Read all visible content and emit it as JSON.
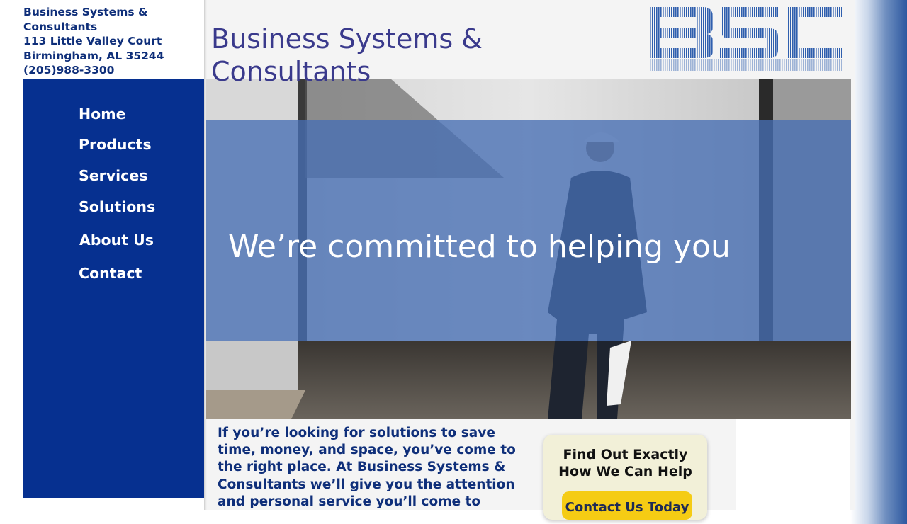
{
  "address": {
    "company": "Business Systems &",
    "company2": "Consultants",
    "street": "113 Little Valley Court",
    "city": "Birmingham, AL 35244",
    "phone": "(205)988-3300"
  },
  "site_title": {
    "line1": "Business Systems &",
    "line2": "Consultants"
  },
  "logo": {
    "text": "BSC"
  },
  "nav": {
    "items": [
      {
        "label": "Home"
      },
      {
        "label": "Products"
      },
      {
        "label": "Services"
      },
      {
        "label": "Solutions"
      },
      {
        "label": "About Us"
      },
      {
        "label": "Contact"
      }
    ]
  },
  "hero": {
    "tagline": "We’re committed to helping you"
  },
  "intro": {
    "lines": [
      "If you’re looking for solutions to save",
      "time, money, and space, you’ve come to",
      "the right place. At Business Systems &",
      "Consultants we’ll give you the attention",
      "and personal service you’ll come to"
    ]
  },
  "promo": {
    "heading1": "Find Out Exactly",
    "heading2": "How We Can Help",
    "button_label": "Contact Us Today"
  },
  "colors": {
    "sidebar": "#063090",
    "title": "#3a3a8c",
    "text": "#0f2f7a",
    "overlay": "#466eb4",
    "button": "#f5cc14"
  }
}
